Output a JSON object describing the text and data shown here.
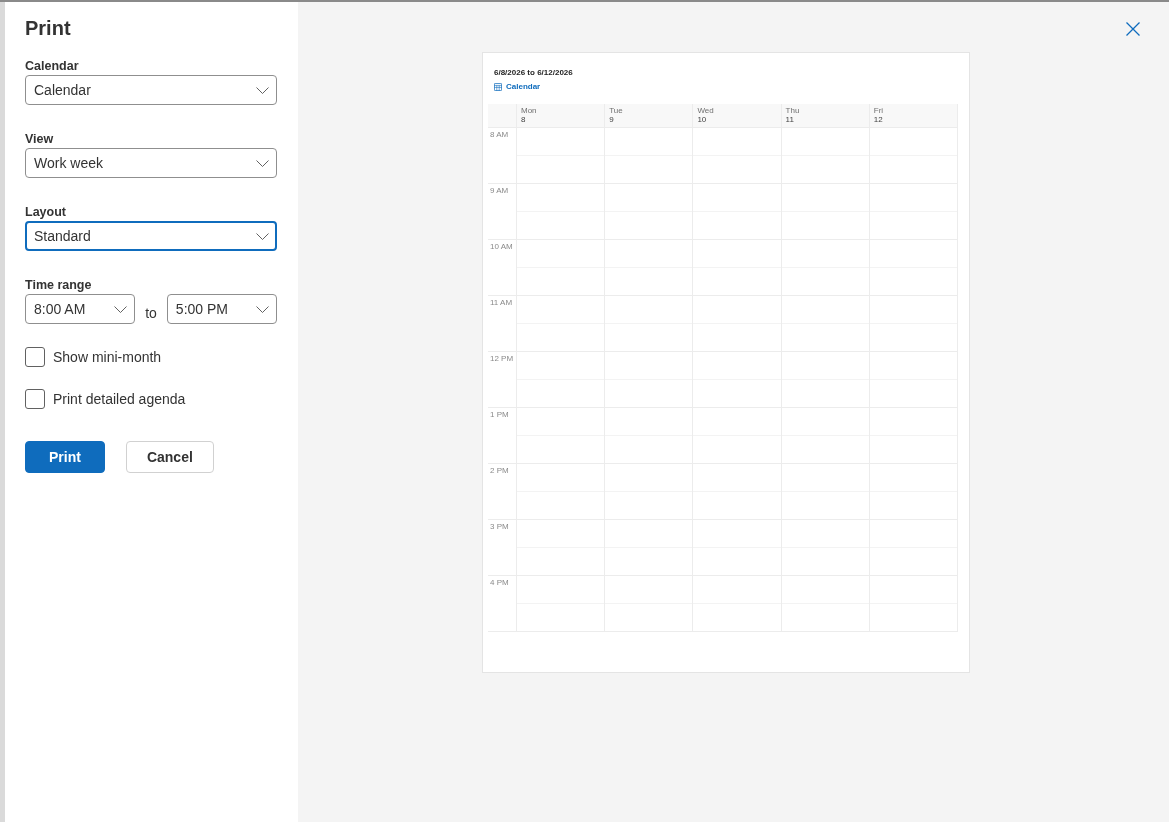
{
  "dialog": {
    "title": "Print"
  },
  "fields": [
    {
      "kind": "select",
      "label": "Calendar",
      "value": "Calendar",
      "focused": false
    },
    {
      "kind": "select",
      "label": "View",
      "value": "Work week",
      "focused": false
    },
    {
      "kind": "select",
      "label": "Layout",
      "value": "Standard",
      "focused": true
    },
    {
      "kind": "range",
      "label": "Time range",
      "from": {
        "value": "8:00 AM",
        "focused": false
      },
      "joiner": "to",
      "to": {
        "value": "5:00 PM",
        "focused": false
      }
    }
  ],
  "options": [
    {
      "label": "Show mini-month",
      "checked": false
    },
    {
      "label": "Print detailed agenda",
      "checked": false
    }
  ],
  "buttons": [
    {
      "label": "Print",
      "kind": "primary"
    },
    {
      "label": "Cancel",
      "kind": "secondary"
    }
  ],
  "preview": {
    "date_range": "6/8/2026 to 6/12/2026",
    "calendar_name": "Calendar",
    "days": [
      {
        "name": "Mon",
        "date": "8"
      },
      {
        "name": "Tue",
        "date": "9"
      },
      {
        "name": "Wed",
        "date": "10"
      },
      {
        "name": "Thu",
        "date": "11"
      },
      {
        "name": "Fri",
        "date": "12"
      }
    ],
    "hours": [
      "8 AM",
      "9 AM",
      "10 AM",
      "11 AM",
      "12 PM",
      "1 PM",
      "2 PM",
      "3 PM",
      "4 PM"
    ]
  }
}
